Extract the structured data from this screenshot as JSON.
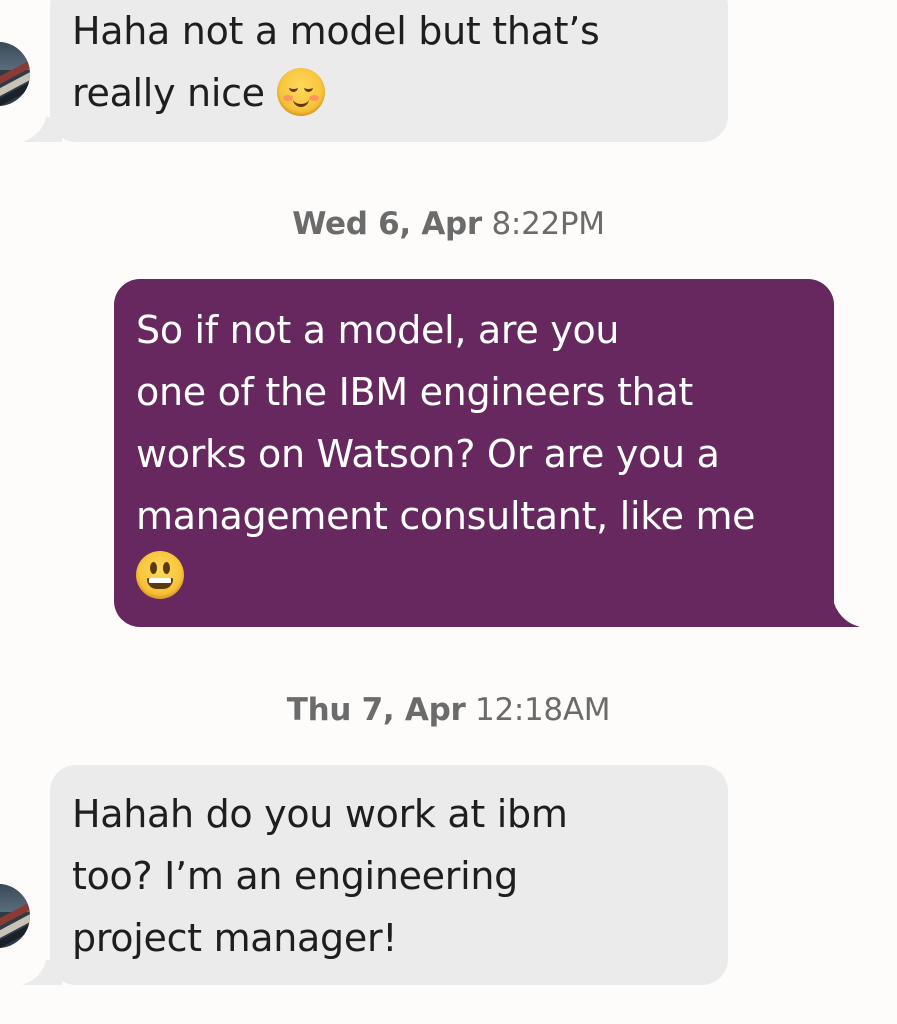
{
  "conversation": {
    "messages": [
      {
        "direction": "incoming",
        "lines": [
          "Haha not a model but that’s",
          "really nice"
        ],
        "emoji": "smiling-blush-emoji"
      },
      {
        "direction": "divider",
        "day": "Wed 6, Apr",
        "time": "8:22PM"
      },
      {
        "direction": "outgoing",
        "lines": [
          "So if not a model, are you",
          "one of the IBM engineers that",
          "works on Watson? Or are you a",
          "management consultant, like me"
        ],
        "emoji": "grinning-emoji"
      },
      {
        "direction": "divider",
        "day": "Thu 7, Apr",
        "time": "12:18AM"
      },
      {
        "direction": "incoming",
        "lines": [
          "Hahah do you work at ibm",
          "too? I’m an engineering",
          "project manager!"
        ]
      }
    ]
  },
  "colors": {
    "background": "#fdfcfb",
    "incoming_bubble": "#ebebeb",
    "outgoing_bubble": "#66285e",
    "timestamp_text": "#6b6b6b",
    "incoming_text": "#1e1e1e",
    "outgoing_text": "#ffffff"
  }
}
